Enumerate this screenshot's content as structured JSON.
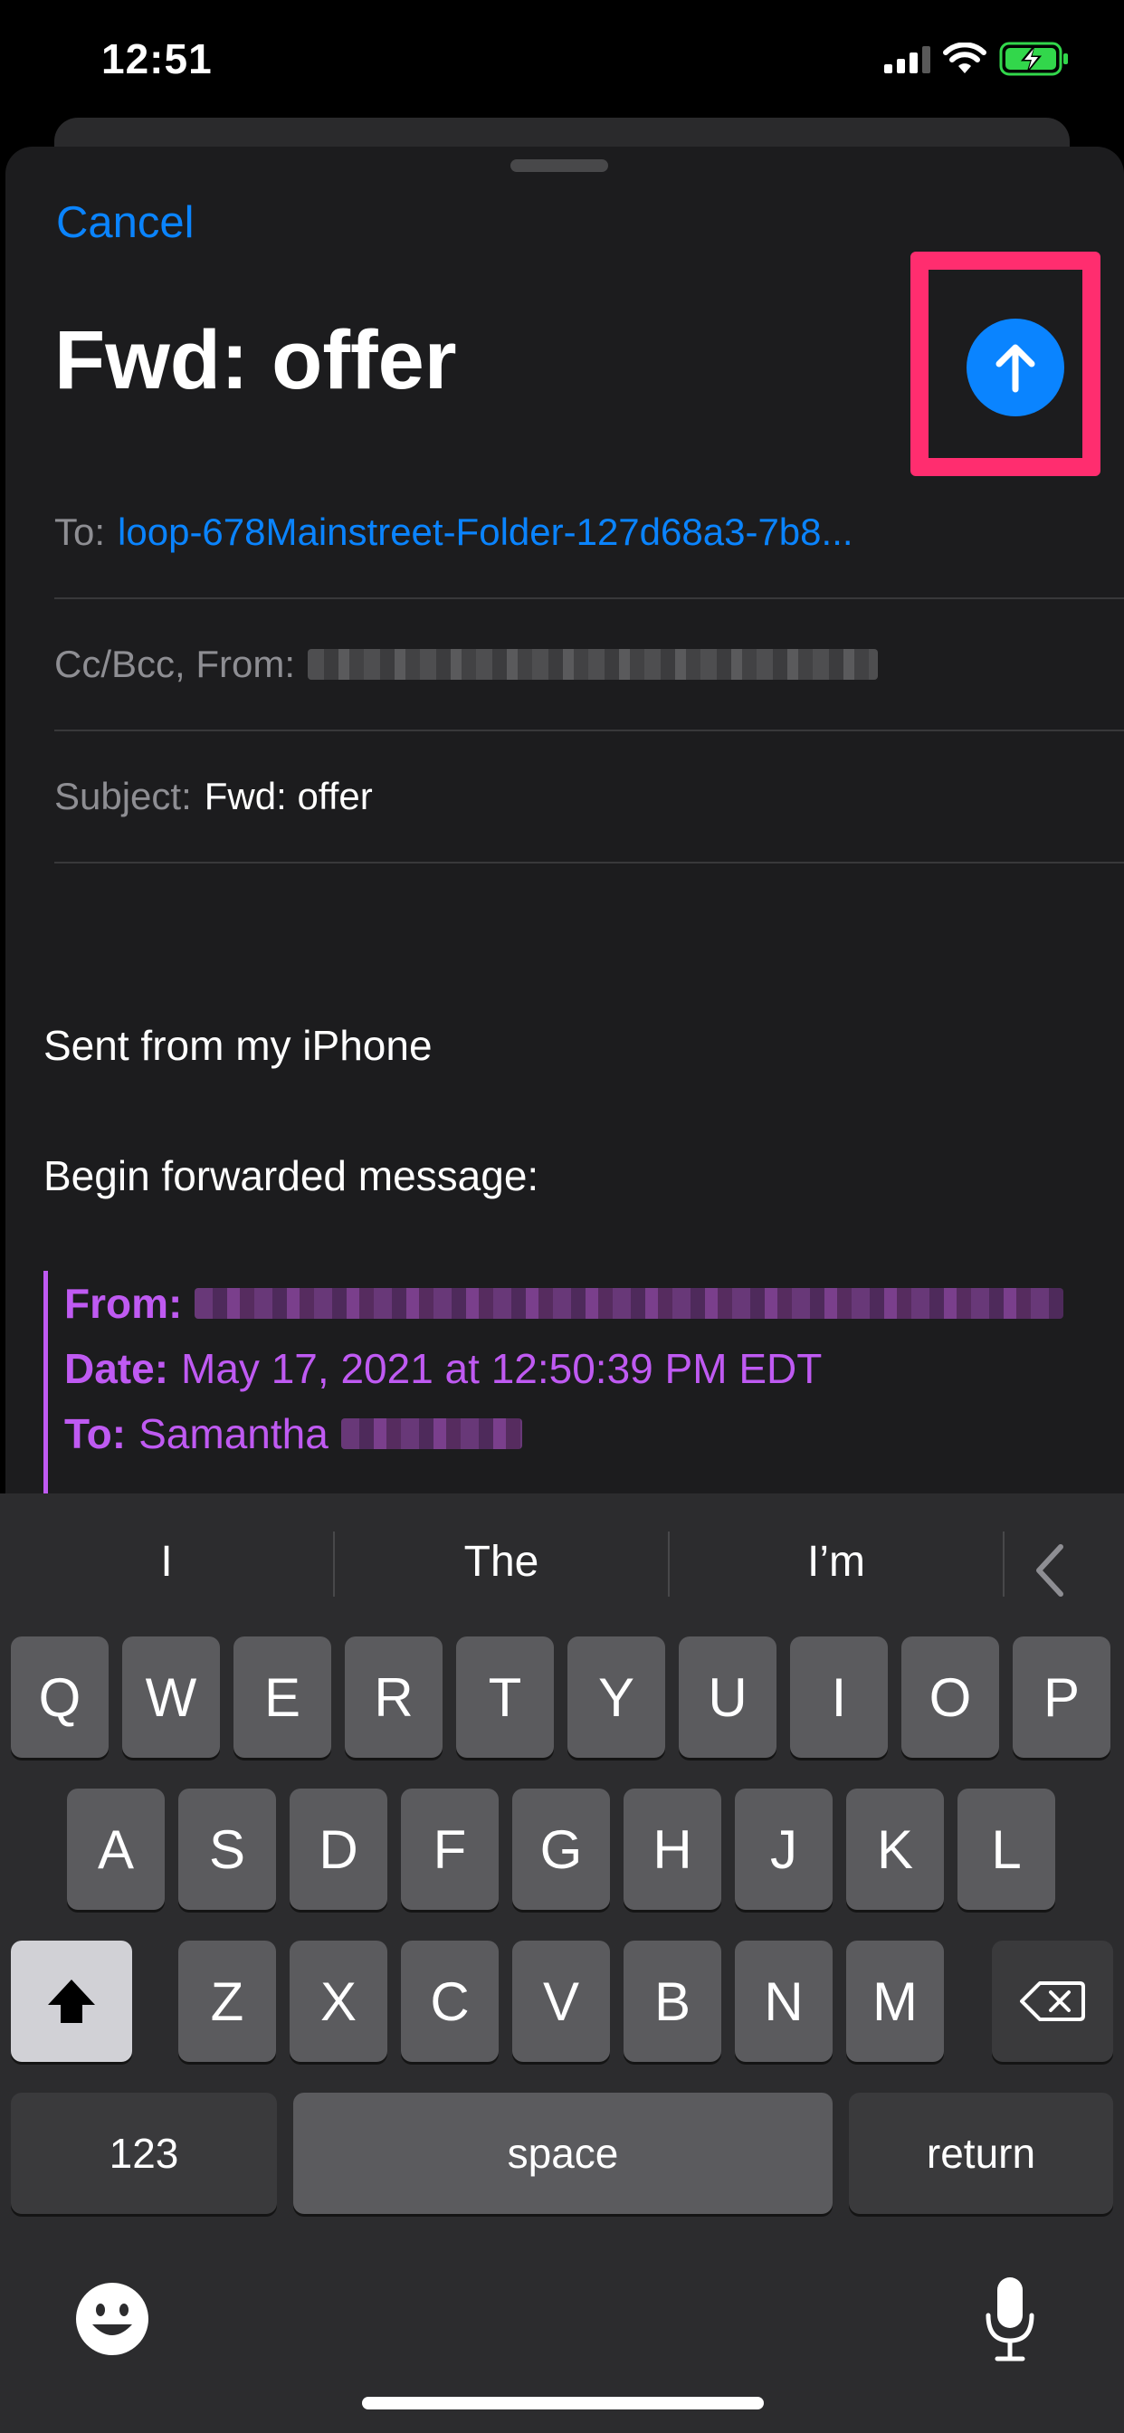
{
  "status_bar": {
    "time": "12:51"
  },
  "compose": {
    "cancel_label": "Cancel",
    "title": "Fwd: offer",
    "to_label": "To:",
    "to_value": "loop-678Mainstreet-Folder-127d68a3-7b8...",
    "cc_label": "Cc/Bcc, From:",
    "subject_label": "Subject:",
    "subject_value": "Fwd: offer"
  },
  "body": {
    "signature": "Sent from my iPhone",
    "forward_intro": "Begin forwarded message:",
    "quoted": {
      "from_label": "From:",
      "date_label": "Date:",
      "date_value": "May 17, 2021 at 12:50:39 PM EDT",
      "to_label": "To:",
      "to_value": "Samantha"
    }
  },
  "keyboard": {
    "suggestions": [
      "I",
      "The",
      "I’m"
    ],
    "row1": [
      "Q",
      "W",
      "E",
      "R",
      "T",
      "Y",
      "U",
      "I",
      "O",
      "P"
    ],
    "row2": [
      "A",
      "S",
      "D",
      "F",
      "G",
      "H",
      "J",
      "K",
      "L"
    ],
    "row3": [
      "Z",
      "X",
      "C",
      "V",
      "B",
      "N",
      "M"
    ],
    "numbers_label": "123",
    "space_label": "space",
    "return_label": "return"
  },
  "colors": {
    "accent": "#0a84ff",
    "highlight": "#ff2d6f",
    "quote": "#bf5af2"
  },
  "icons": {
    "send": "arrow-up-icon",
    "shift": "shift-icon",
    "delete": "backspace-icon",
    "emoji": "emoji-icon",
    "dictation": "microphone-icon",
    "collapse": "chevron-left-icon"
  }
}
